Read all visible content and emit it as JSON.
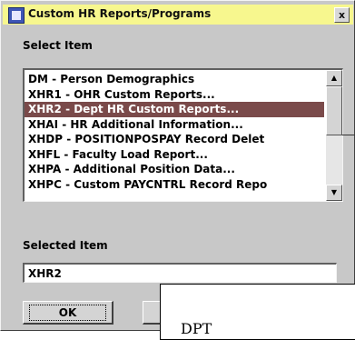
{
  "window": {
    "title": "Custom HR Reports/Programs",
    "close_label": "x"
  },
  "select_label": "Select Item",
  "list": {
    "items": [
      {
        "label": "DM - Person Demographics",
        "selected": false
      },
      {
        "label": "XHR1 - OHR Custom Reports...",
        "selected": false
      },
      {
        "label": "XHR2 - Dept HR Custom Reports...",
        "selected": true
      },
      {
        "label": "XHAI - HR Additional Information...",
        "selected": false
      },
      {
        "label": "XHDP - POSITIONPOSPAY Record Delet",
        "selected": false
      },
      {
        "label": "XHFL - Faculty Load Report...",
        "selected": false
      },
      {
        "label": "XHPA - Additional Position Data...",
        "selected": false
      },
      {
        "label": "XHPC - Custom PAYCNTRL Record Repo",
        "selected": false
      }
    ],
    "scroll_up_icon": "triangle-up",
    "scroll_down_icon": "triangle-down"
  },
  "selected_label": "Selected Item",
  "selected_value": "XHR2",
  "buttons": {
    "ok_label": "OK"
  },
  "overlay": {
    "text": "DPT"
  },
  "colors": {
    "titlebar": "#f7f78e",
    "selection": "#7a4a4a",
    "dialog_bg": "#c8c8c8"
  }
}
